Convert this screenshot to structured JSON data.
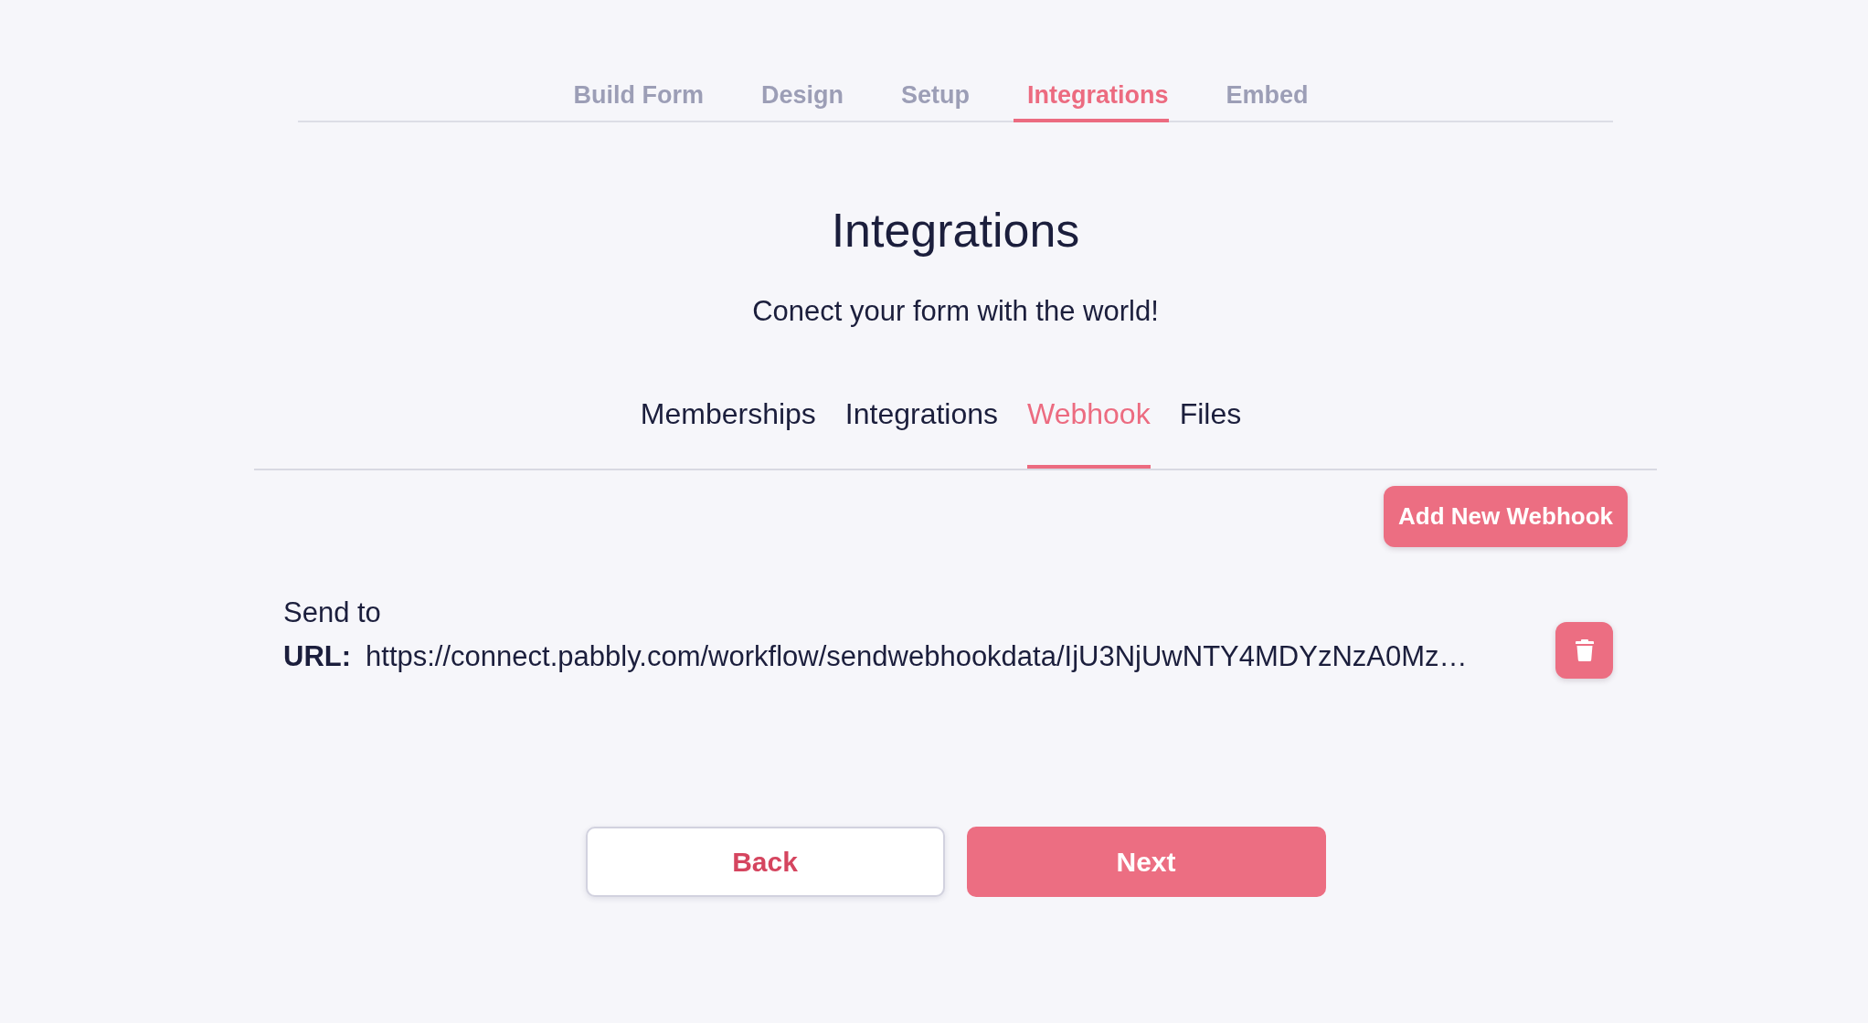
{
  "steps": [
    {
      "label": "Build Form",
      "selected": false
    },
    {
      "label": "Design",
      "selected": false
    },
    {
      "label": "Setup",
      "selected": false
    },
    {
      "label": "Integrations",
      "selected": true
    },
    {
      "label": "Embed",
      "selected": false
    }
  ],
  "heading": {
    "title": "Integrations",
    "subtitle": "Conect your form with the world!"
  },
  "tabs": [
    {
      "label": "Memberships",
      "selected": false
    },
    {
      "label": "Integrations",
      "selected": false
    },
    {
      "label": "Webhook",
      "selected": true
    },
    {
      "label": "Files",
      "selected": false
    }
  ],
  "add_button": "Add New Webhook",
  "webhooks": [
    {
      "send_label": "Send to",
      "url_label": "URL:",
      "url": "https://connect.pabbly.com/workflow/sendwebhookdata/IjU3NjUwNTY4MDYzNzA0Mz…"
    }
  ],
  "footer": {
    "back": "Back",
    "next": "Next"
  }
}
